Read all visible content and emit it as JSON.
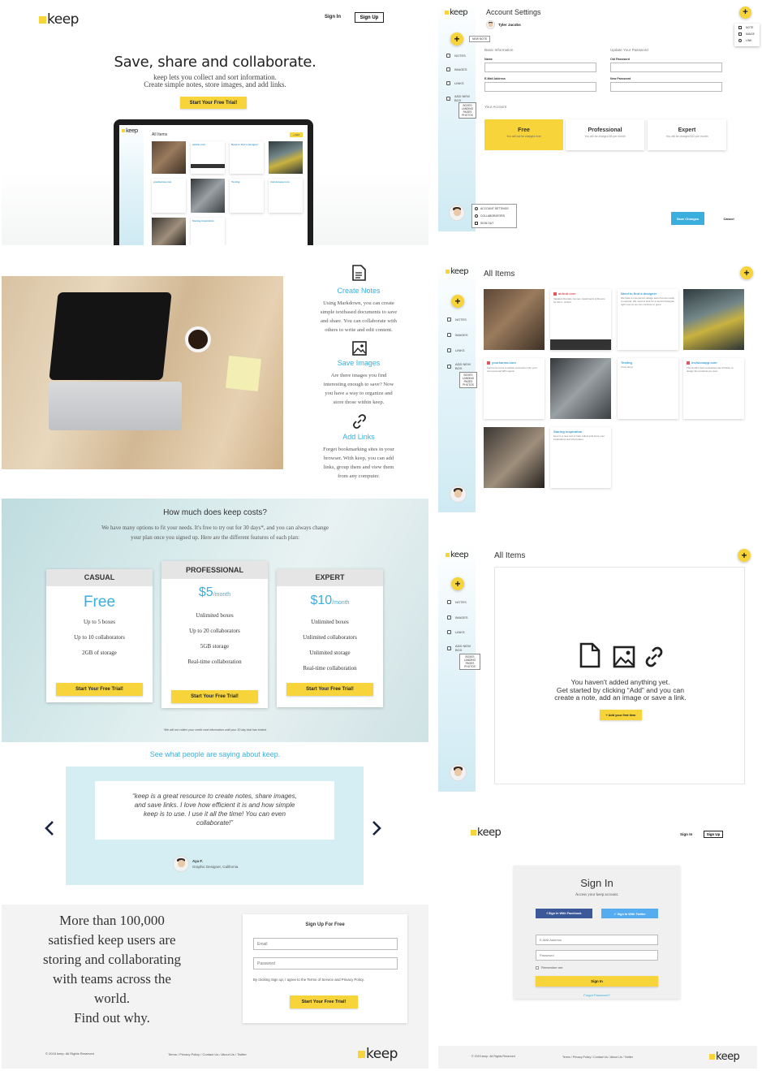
{
  "landing": {
    "logo": "keep",
    "nav": {
      "signin": "Sign In",
      "signup": "Sign Up"
    },
    "hero": {
      "title": "Save, share and collaborate.",
      "line1": "keep lets you collect and sort information.",
      "line2": "Create simple notes, store images, and add links.",
      "cta": "Start Your Free Trial!"
    },
    "laptop": {
      "logo": "keep",
      "heading": "All Items",
      "add": "+ Add",
      "cards": [
        {
          "title": "airbnb.com",
          "text": "Vacation Rentals, Homes"
        },
        {
          "title": "Need to find a designer",
          "text": "We have a one-person design team"
        },
        {
          "title": "yourkarma.com",
          "text": "Karma Go turns a cellular connection"
        },
        {
          "title": "Testing",
          "text": "I love lamp."
        },
        {
          "title": "invisionapp.com",
          "text": "The world's best companies"
        },
        {
          "title": "Staring inspiration",
          "text": "keep is a new tool"
        }
      ]
    },
    "features": [
      {
        "title": "Create Notes",
        "icon": "document-icon",
        "text": [
          "Using Markdown, you can create",
          "simple textbased documents to save",
          "and share. You can collaborate with",
          "others to write and edit content."
        ]
      },
      {
        "title": "Save Images",
        "icon": "image-icon",
        "text": [
          "Are there images you find",
          "interesting enough to save? Now",
          "you have a way to organize and",
          "store those within keep."
        ]
      },
      {
        "title": "Add Links",
        "icon": "link-icon",
        "text": [
          "Forget bookmarking sites in your",
          "browser. With keep, you can add",
          "links, group them and view them",
          "from any computer."
        ]
      }
    ],
    "pricing": {
      "title": "How much does keep costs?",
      "sub1": "We have many options to fit your needs. It's free to try out for 30 days*, and you can always change",
      "sub2": "your plan once you signed up. Here are the different features of each plan:",
      "plans": [
        {
          "name": "CASUAL",
          "price": "Free",
          "per": "",
          "features": [
            "Up to 5 boxes",
            "Up to 10 collaborators",
            "2GB of storage"
          ],
          "cta": "Start Your Free Trial!"
        },
        {
          "name": "PROFESSIONAL",
          "price": "$5",
          "per": "/month",
          "features": [
            "Unlimited boxes",
            "Up to 20 collaborators",
            "5GB storage",
            "Real-time collaboration"
          ],
          "cta": "Start Your Free Trial!"
        },
        {
          "name": "EXPERT",
          "price": "$10",
          "per": "/month",
          "features": [
            "Unlimited boxes",
            "Unlimited collaborators",
            "Unlimited storage",
            "Real-time collaboration"
          ],
          "cta": "Start Your Free Trial!"
        }
      ],
      "footnote": "*We will not collect your credit card information until your 30 day trial has ended."
    },
    "testimonials": {
      "heading": "See what people are saying about keep.",
      "quote": [
        "“keep is a great resource to create notes, share images,",
        "and save links. I love how efficient it is and how simple",
        "keep is to use. I use it all the time! You can even",
        "collaborate!”"
      ],
      "name": "Aya F.",
      "role": "Graphic Designer, California"
    },
    "signup": {
      "pitch": [
        "More than 100,000",
        "satisfied keep users are",
        "storing and collaborating",
        "with teams across the",
        "world.",
        "Find out why."
      ],
      "title": "Sign Up For Free",
      "email_ph": "Email",
      "password_ph": "Password",
      "terms": "By clicking Sign up, I agree to the Terms of Service and Privacy Policy.",
      "cta": "Start Your Free Trial!"
    },
    "footer": {
      "copy": "© 2015 keep. All Rights Reserved",
      "links": "Terms / Privacy Policy / Contact Us / About Us / Twitter",
      "logo": "keep"
    }
  },
  "settings": {
    "logo": "keep",
    "title": "Account Settings",
    "user": "Tyler Jacobs",
    "new_note": "NEW NOTE",
    "menu": [
      "NOTE",
      "IMAGE",
      "LINK"
    ],
    "basic": "Basic Information",
    "name": "Name",
    "email": "E-Mail Address",
    "update": "Update Your Password",
    "old": "Old Password",
    "new": "New Password",
    "account": "Your Account",
    "plans": [
      {
        "name": "Free",
        "desc": "You will not be charged ever"
      },
      {
        "name": "Professional",
        "desc": "You will be charged $5 per month"
      },
      {
        "name": "Expert",
        "desc": "You will be charged $10 per month"
      }
    ],
    "save": "Save Changes",
    "cancel": "Cancel",
    "usermenu": [
      "ACCOUNT SETTINGS",
      "COLLABORATORS",
      "SIGN OUT"
    ]
  },
  "sidebar": {
    "items": [
      "NOTES",
      "IMAGES",
      "LINKS",
      "ADD NEW BOX"
    ],
    "boxes": [
      "BOXES",
      "LANDING PAGES",
      "PHOTOS"
    ]
  },
  "allitems": {
    "logo": "keep",
    "heading": "All Items",
    "cards": [
      {
        "title": "airbnb.com",
        "text": "Vacation Rentals, Homes, Apartments & Rooms for Rent - Airbnb"
      },
      {
        "title": "Need to find a designer",
        "text": "We have a one-person design team but are ready to expand. We need to look for a second designer right now so we can continue to grow."
      },
      {
        "title": "yourkarma.com",
        "text": "Karma Go turns a cellular connection into your own personal WiFi signal."
      },
      {
        "title": "Testing",
        "text": "I love lamp."
      },
      {
        "title": "invisionapp.com",
        "text": "The world's best companies use InVision to design the products you love."
      },
      {
        "title": "Staring inspiration",
        "text": "keep is a new tool to help collect and store your inspirations and information."
      }
    ]
  },
  "empty": {
    "logo": "keep",
    "heading": "All Items",
    "msg": [
      "You haven't added anything yet.",
      "Get started by clicking “Add” and you can",
      "create a note, add an image or save a link."
    ],
    "cta": "+ Add your first item"
  },
  "signin": {
    "logo": "keep",
    "nav": {
      "signin": "Sign In",
      "signup": "Sign Up"
    },
    "title": "Sign In",
    "sub": "Access your keep account.",
    "fb": "Sign In With Facebook",
    "tw": "Sign In With Twitter",
    "email_ph": "E-Mail Address",
    "password_ph": "Password",
    "remember": "Remember me",
    "cta": "Sign In",
    "forgot": "Forgot Password?",
    "footer": {
      "copy": "© 2015 keep. All Rights Reserved",
      "links": "Terms / Privacy Policy / Contact Us / About Us / Twitter",
      "logo": "keep"
    }
  },
  "colors": {
    "accent": "#f7d43a",
    "blue": "#3aaedc"
  }
}
